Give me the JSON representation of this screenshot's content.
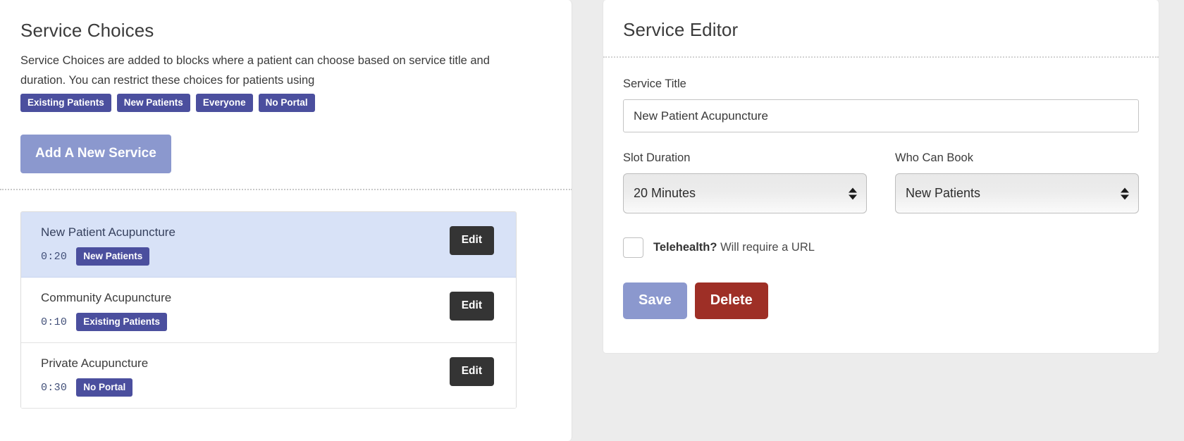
{
  "left_panel": {
    "title": "Service Choices",
    "description": "Service Choices are added to blocks where a patient can choose based on service title and duration. You can restrict these choices for patients using",
    "restriction_badges": [
      {
        "label": "Existing Patients"
      },
      {
        "label": "New Patients"
      },
      {
        "label": "Everyone"
      },
      {
        "label": "No Portal"
      }
    ],
    "add_service_label": "Add A New Service",
    "services": [
      {
        "name": "New Patient Acupuncture",
        "duration": "0:20",
        "audience": "New Patients",
        "edit_label": "Edit",
        "selected": true
      },
      {
        "name": "Community Acupuncture",
        "duration": "0:10",
        "audience": "Existing Patients",
        "edit_label": "Edit",
        "selected": false
      },
      {
        "name": "Private Acupuncture",
        "duration": "0:30",
        "audience": "No Portal",
        "edit_label": "Edit",
        "selected": false
      }
    ]
  },
  "editor": {
    "title": "Service Editor",
    "service_title_label": "Service Title",
    "service_title_value": "New Patient Acupuncture",
    "service_title_placeholder": "Service Title",
    "slot_duration_label": "Slot Duration",
    "slot_duration_value": "20 Minutes",
    "slot_duration_options": [
      "20 Minutes"
    ],
    "who_can_book_label": "Who Can Book",
    "who_can_book_value": "New Patients",
    "who_can_book_options": [
      "New Patients"
    ],
    "telehealth_label_bold": "Telehealth?",
    "telehealth_label_rest": "Will require a URL",
    "telehealth_checked": false,
    "save_label": "Save",
    "delete_label": "Delete"
  },
  "colors": {
    "badge_purple": "#4b4f9e",
    "primary_button": "#8b98ce",
    "danger_button": "#9e2f26",
    "edit_button": "#343434",
    "selected_row": "#d8e2f7",
    "page_background": "#ececec"
  }
}
